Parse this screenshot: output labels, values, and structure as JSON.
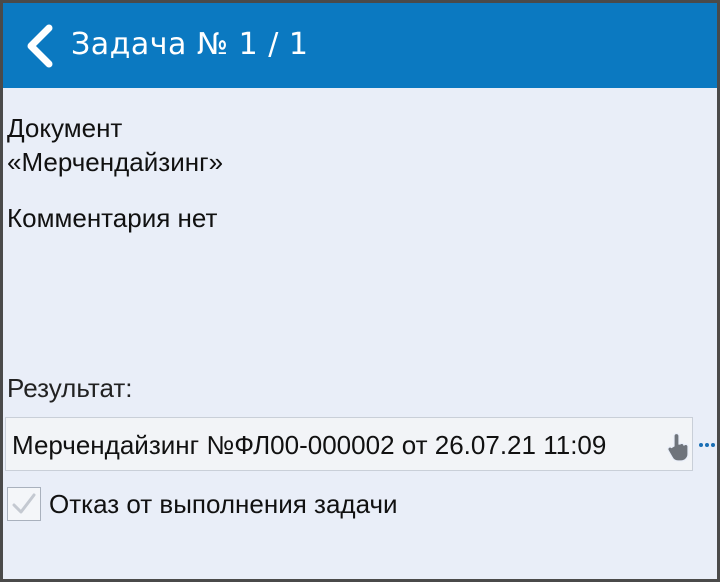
{
  "header": {
    "title": "Задача № 1 / 1",
    "back_icon": "chevron-left-icon",
    "background_color": "#0b79c1"
  },
  "task": {
    "document_label": "Документ",
    "document_name": "«Мерчендайзинг»",
    "comment": "Комментария нет"
  },
  "result": {
    "label": "Результат:",
    "value": "Мерчендайзинг №ФЛ00-000002 от 26.07.21 11:09",
    "tap_icon": "hand-pointer-icon",
    "more_icon": "ellipsis-icon"
  },
  "refusal": {
    "label": "Отказ от выполнения задачи",
    "checked": false
  }
}
